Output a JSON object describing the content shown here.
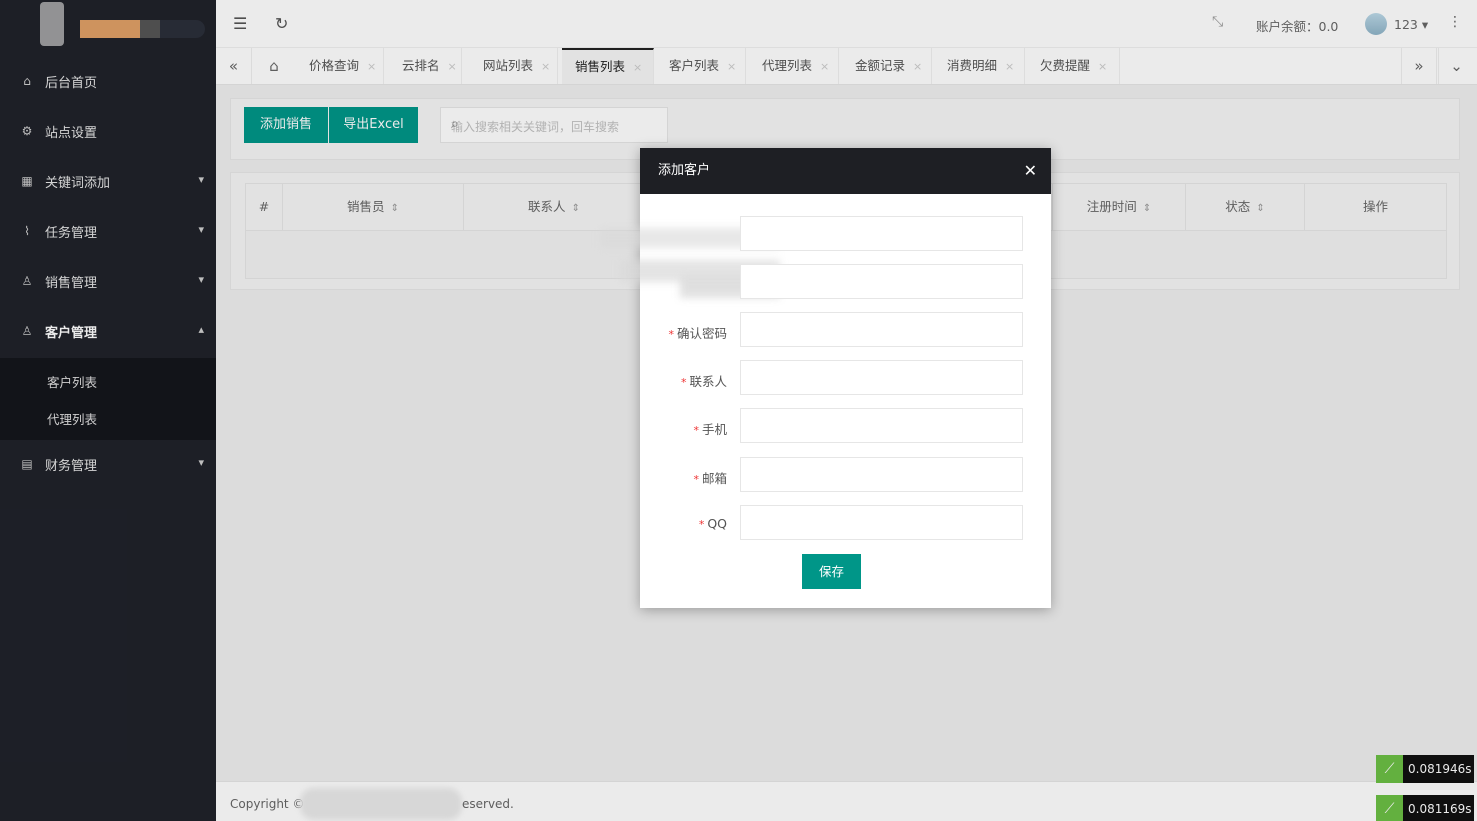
{
  "sidebar": {
    "items": [
      {
        "label": "后台首页",
        "icon": "home-icon"
      },
      {
        "label": "站点设置",
        "icon": "gear-icon"
      },
      {
        "label": "关键词添加",
        "icon": "grid-icon"
      },
      {
        "label": "任务管理",
        "icon": "pulse-icon"
      },
      {
        "label": "销售管理",
        "icon": "user-icon"
      },
      {
        "label": "客户管理",
        "icon": "users-icon"
      },
      {
        "label": "财务管理",
        "icon": "calendar-icon"
      }
    ],
    "subitems": [
      "客户列表",
      "代理列表"
    ]
  },
  "topbar": {
    "balance": "账户余额：0.0",
    "username": "123"
  },
  "tabs": [
    "价格查询",
    "云排名",
    "网站列表",
    "销售列表",
    "客户列表",
    "代理列表",
    "金额记录",
    "消费明细",
    "欠费提醒"
  ],
  "toolbar": {
    "add_label": "添加销售",
    "export_label": "导出Excel",
    "search_placeholder": "输入搜索相关关键词，回车搜索"
  },
  "table": {
    "headers": [
      "#",
      "销售员",
      "联系人",
      "注册时间",
      "状态",
      "操作"
    ]
  },
  "modal": {
    "title": "添加客户",
    "fields": [
      {
        "label": "",
        "required": false
      },
      {
        "label": "",
        "required": false
      },
      {
        "label": "确认密码",
        "required": true
      },
      {
        "label": "联系人",
        "required": true
      },
      {
        "label": "手机",
        "required": true
      },
      {
        "label": "邮箱",
        "required": true
      },
      {
        "label": "QQ",
        "required": true
      }
    ],
    "save_label": "保存"
  },
  "footer": {
    "copyright": "Copyright ©",
    "reserved": "eserved."
  },
  "timers": [
    "0.081946s",
    "0.081169s"
  ],
  "colors": {
    "sidebar_bg": "#20222a",
    "accent": "#009688",
    "modal_header": "#1e1f24"
  }
}
